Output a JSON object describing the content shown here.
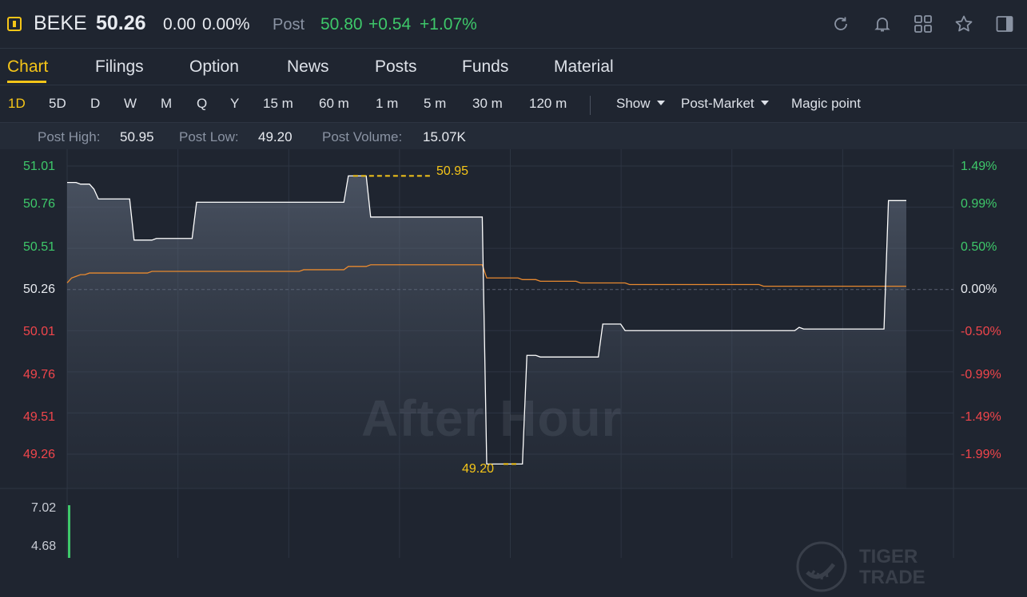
{
  "header": {
    "ticker": "BEKE",
    "price": "50.26",
    "change": "0.00",
    "change_pct": "0.00%",
    "post_label": "Post",
    "post_price": "50.80",
    "post_change": "+0.54",
    "post_change_pct": "+1.07%",
    "icons": [
      "refresh-icon",
      "bell-icon",
      "grid-icon",
      "star-icon",
      "panel-icon"
    ]
  },
  "tabs": [
    "Chart",
    "Filings",
    "Option",
    "News",
    "Posts",
    "Funds",
    "Material"
  ],
  "active_tab": "Chart",
  "periods": [
    "1D",
    "5D",
    "D",
    "W",
    "M",
    "Q",
    "Y",
    "15 m",
    "60 m",
    "1 m",
    "5 m",
    "30 m",
    "120 m"
  ],
  "active_period": "1D",
  "controls": {
    "show": "Show",
    "session": "Post-Market",
    "magic": "Magic point"
  },
  "info": {
    "high_label": "Post High:",
    "high_value": "50.95",
    "low_label": "Post Low:",
    "low_value": "49.20",
    "volume_label": "Post Volume:",
    "volume_value": "15.07K"
  },
  "watermark": "After Hour",
  "brand_watermark": {
    "line1": "TIGER",
    "line2": "TRADE"
  },
  "colors": {
    "accent": "#f5c518",
    "up": "#3ec86a",
    "down": "#f0454b",
    "avg_line": "#e8892f",
    "price_line": "#ffffff",
    "background": "#1f2530"
  },
  "chart_data": {
    "type": "line",
    "ylim": [
      49.13,
      51.01
    ],
    "base_price": 50.26,
    "y_ticks_left": [
      "51.01",
      "50.76",
      "50.51",
      "50.26",
      "50.01",
      "49.76",
      "49.51",
      "49.26"
    ],
    "y_ticks_right": [
      "1.49%",
      "0.99%",
      "0.50%",
      "0.00%",
      "-0.50%",
      "-0.99%",
      "-1.49%",
      "-1.99%"
    ],
    "high_marker": "50.95",
    "low_marker": "49.20",
    "series": [
      {
        "values": [
          50.91,
          50.91,
          50.91,
          50.9,
          50.9,
          50.9,
          50.87,
          50.81,
          50.81,
          50.81,
          50.81,
          50.81,
          50.81,
          50.81,
          50.81,
          50.56,
          50.56,
          50.56,
          50.56,
          50.56,
          50.57,
          50.57,
          50.57,
          50.57,
          50.57,
          50.57,
          50.57,
          50.57,
          50.57,
          50.79,
          50.79,
          50.79,
          50.79,
          50.79,
          50.79,
          50.79,
          50.79,
          50.79,
          50.79,
          50.79,
          50.79,
          50.79,
          50.79,
          50.79,
          50.79,
          50.79,
          50.79,
          50.79,
          50.79,
          50.79,
          50.79,
          50.79,
          50.79,
          50.79,
          50.79,
          50.79,
          50.79,
          50.79,
          50.79,
          50.79,
          50.79,
          50.79,
          50.79,
          50.95,
          50.95,
          50.95,
          50.95,
          50.95,
          50.7,
          50.7,
          50.7,
          50.7,
          50.7,
          50.7,
          50.7,
          50.7,
          50.7,
          50.7,
          50.7,
          50.7,
          50.7,
          50.7,
          50.7,
          50.7,
          50.7,
          50.7,
          50.7,
          50.7,
          50.7,
          50.7,
          50.7,
          50.7,
          50.7,
          50.7,
          49.2,
          49.2,
          49.2,
          49.2,
          49.2,
          49.2,
          49.2,
          49.2,
          49.2,
          49.86,
          49.86,
          49.86,
          49.85,
          49.85,
          49.85,
          49.85,
          49.85,
          49.85,
          49.85,
          49.85,
          49.85,
          49.85,
          49.85,
          49.85,
          49.85,
          49.85,
          50.05,
          50.05,
          50.05,
          50.05,
          50.05,
          50.01,
          50.01,
          50.01,
          50.01,
          50.01,
          50.01,
          50.01,
          50.01,
          50.01,
          50.01,
          50.01,
          50.01,
          50.01,
          50.01,
          50.01,
          50.01,
          50.01,
          50.01,
          50.01,
          50.01,
          50.01,
          50.01,
          50.01,
          50.01,
          50.01,
          50.01,
          50.01,
          50.01,
          50.01,
          50.01,
          50.01,
          50.01,
          50.01,
          50.01,
          50.01,
          50.01,
          50.01,
          50.01,
          50.01,
          50.03,
          50.02,
          50.02,
          50.02,
          50.02,
          50.02,
          50.02,
          50.02,
          50.02,
          50.02,
          50.02,
          50.02,
          50.02,
          50.02,
          50.02,
          50.02,
          50.02,
          50.02,
          50.02,
          50.02,
          50.8,
          50.8,
          50.8,
          50.8,
          50.8
        ]
      },
      {
        "values": [
          50.3,
          50.33,
          50.34,
          50.35,
          50.35,
          50.36,
          50.36,
          50.36,
          50.36,
          50.36,
          50.36,
          50.36,
          50.36,
          50.36,
          50.36,
          50.36,
          50.36,
          50.36,
          50.36,
          50.37,
          50.37,
          50.37,
          50.37,
          50.37,
          50.37,
          50.37,
          50.37,
          50.37,
          50.37,
          50.37,
          50.37,
          50.37,
          50.37,
          50.37,
          50.37,
          50.37,
          50.37,
          50.37,
          50.37,
          50.37,
          50.37,
          50.37,
          50.37,
          50.37,
          50.37,
          50.37,
          50.37,
          50.37,
          50.37,
          50.37,
          50.37,
          50.37,
          50.37,
          50.38,
          50.38,
          50.38,
          50.38,
          50.38,
          50.38,
          50.38,
          50.38,
          50.38,
          50.38,
          50.4,
          50.4,
          50.4,
          50.4,
          50.4,
          50.41,
          50.41,
          50.41,
          50.41,
          50.41,
          50.41,
          50.41,
          50.41,
          50.41,
          50.41,
          50.41,
          50.41,
          50.41,
          50.41,
          50.41,
          50.41,
          50.41,
          50.41,
          50.41,
          50.41,
          50.41,
          50.41,
          50.41,
          50.41,
          50.41,
          50.41,
          50.33,
          50.33,
          50.33,
          50.33,
          50.33,
          50.33,
          50.33,
          50.33,
          50.32,
          50.32,
          50.32,
          50.32,
          50.31,
          50.31,
          50.31,
          50.31,
          50.31,
          50.31,
          50.31,
          50.31,
          50.31,
          50.3,
          50.3,
          50.3,
          50.3,
          50.3,
          50.3,
          50.3,
          50.3,
          50.3,
          50.3,
          50.3,
          50.29,
          50.29,
          50.29,
          50.29,
          50.29,
          50.29,
          50.29,
          50.29,
          50.29,
          50.29,
          50.29,
          50.29,
          50.29,
          50.29,
          50.29,
          50.29,
          50.29,
          50.29,
          50.29,
          50.29,
          50.29,
          50.29,
          50.29,
          50.29,
          50.29,
          50.29,
          50.29,
          50.29,
          50.29,
          50.29,
          50.28,
          50.28,
          50.28,
          50.28,
          50.28,
          50.28,
          50.28,
          50.28,
          50.28,
          50.28,
          50.28,
          50.28,
          50.28,
          50.28,
          50.28,
          50.28,
          50.28,
          50.28,
          50.28,
          50.28,
          50.28,
          50.28,
          50.28,
          50.28,
          50.28,
          50.28,
          50.28,
          50.28,
          50.28,
          50.28,
          50.28,
          50.28,
          50.28
        ]
      }
    ],
    "volume_ticks": [
      "7.02",
      "4.68"
    ],
    "volume_bars": [
      7.02
    ]
  }
}
